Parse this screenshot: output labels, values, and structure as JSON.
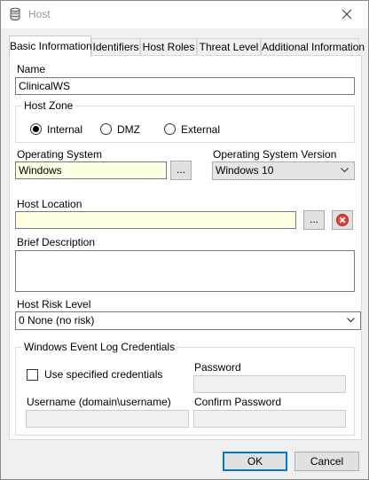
{
  "window": {
    "title": "Host",
    "icon": "database-icon"
  },
  "tabs": [
    {
      "label": "Basic Information",
      "active": true
    },
    {
      "label": "Identifiers"
    },
    {
      "label": "Host Roles"
    },
    {
      "label": "Threat Level"
    },
    {
      "label": "Additional Information"
    }
  ],
  "form": {
    "name_label": "Name",
    "name_value": "ClinicalWS",
    "host_zone_label": "Host Zone",
    "zone_options": [
      "Internal",
      "DMZ",
      "External"
    ],
    "zone_selected": "Internal",
    "os_label": "Operating System",
    "os_value": "Windows",
    "browse_label": "...",
    "os_version_label": "Operating System Version",
    "os_version_value": "Windows 10",
    "host_location_label": "Host Location",
    "host_location_value": "",
    "brief_description_label": "Brief Description",
    "brief_description_value": "",
    "risk_level_label": "Host Risk Level",
    "risk_level_value": "0 None (no risk)"
  },
  "credentials": {
    "group_label": "Windows Event Log Credentials",
    "use_specified_label": "Use specified credentials",
    "use_specified_checked": false,
    "password_label": "Password",
    "username_label": "Username (domain\\username)",
    "confirm_password_label": "Confirm Password"
  },
  "buttons": {
    "ok": "OK",
    "cancel": "Cancel"
  },
  "colors": {
    "required_field": "#ffffe1",
    "clear_icon": "#e0443a",
    "accent": "#0078d7"
  }
}
